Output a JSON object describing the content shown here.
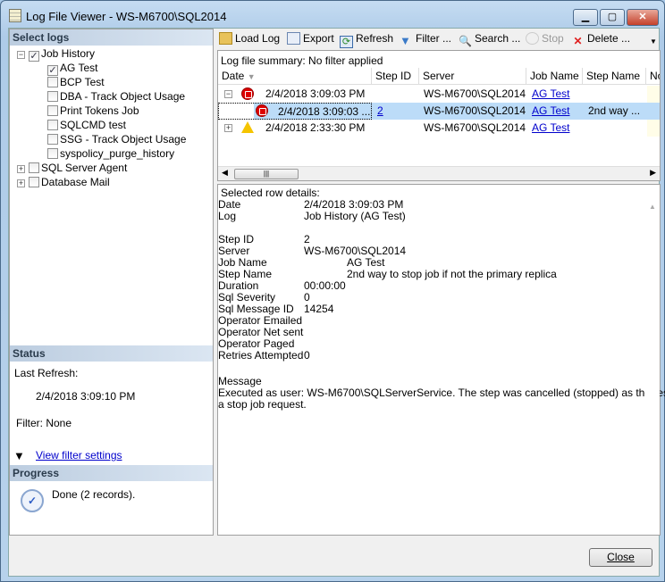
{
  "window": {
    "title": "Log File Viewer - WS-M6700\\SQL2014",
    "minimize": "▁",
    "maximize": "▢",
    "close": "✕"
  },
  "left": {
    "select_logs": "Select logs",
    "tree": [
      {
        "label": "Job History",
        "checked": true,
        "expand": "−"
      },
      {
        "label": "AG Test",
        "checked": true
      },
      {
        "label": "BCP Test"
      },
      {
        "label": "DBA - Track Object Usage"
      },
      {
        "label": "Print Tokens Job"
      },
      {
        "label": "SQLCMD test"
      },
      {
        "label": "SSG - Track Object Usage"
      },
      {
        "label": "syspolicy_purge_history"
      },
      {
        "label": "SQL Server Agent",
        "expand": "+"
      },
      {
        "label": "Database Mail",
        "expand": "+"
      }
    ],
    "status": {
      "title": "Status",
      "last_refresh_label": "Last Refresh:",
      "last_refresh": "2/4/2018 3:09:10 PM",
      "filter": "Filter: None",
      "view_filter": "View filter settings"
    },
    "progress": {
      "title": "Progress",
      "text": "Done (2 records)."
    }
  },
  "toolbar": {
    "load": "Load Log",
    "export": "Export",
    "refresh": "Refresh",
    "filter": "Filter ...",
    "search": "Search ...",
    "stop": "Stop",
    "delete": "Delete ..."
  },
  "summary": "Log file summary: No filter applied",
  "grid": {
    "columns": [
      "Date",
      "Step ID",
      "Server",
      "Job Name",
      "Step Name",
      "No"
    ],
    "rows": [
      {
        "date": "2/4/2018 3:09:03 PM",
        "step": "",
        "server": "WS-M6700\\SQL2014",
        "job": "AG Test",
        "stepname": ""
      },
      {
        "date": "2/4/2018 3:09:03 ...",
        "step": "2",
        "server": "WS-M6700\\SQL2014",
        "job": "AG Test",
        "stepname": "2nd way ..."
      },
      {
        "date": "2/4/2018 2:33:30 PM",
        "step": "",
        "server": "WS-M6700\\SQL2014",
        "job": "AG Test",
        "stepname": ""
      }
    ]
  },
  "details": {
    "title": "Selected row details:",
    "fields": [
      [
        "Date",
        "2/4/2018 3:09:03 PM"
      ],
      [
        "Log",
        "Job History (AG Test)"
      ],
      [
        "Step ID",
        "2"
      ],
      [
        "Server",
        "WS-M6700\\SQL2014"
      ],
      [
        "Job Name",
        "AG Test"
      ],
      [
        "Step Name",
        "2nd way to stop job if not the primary replica"
      ],
      [
        "Duration",
        "00:00:00"
      ],
      [
        "Sql Severity",
        "0"
      ],
      [
        "Sql Message ID",
        "14254"
      ],
      [
        "Operator Emailed",
        ""
      ],
      [
        "Operator Net sent",
        ""
      ],
      [
        "Operator Paged",
        ""
      ],
      [
        "Retries Attempted",
        "0"
      ]
    ],
    "message_label": "Message",
    "message": "Executed as user: WS-M6700\\SQLServerService. The step was cancelled (stopped) as the result of",
    "message2": "a stop job request."
  },
  "close_button": "Close"
}
